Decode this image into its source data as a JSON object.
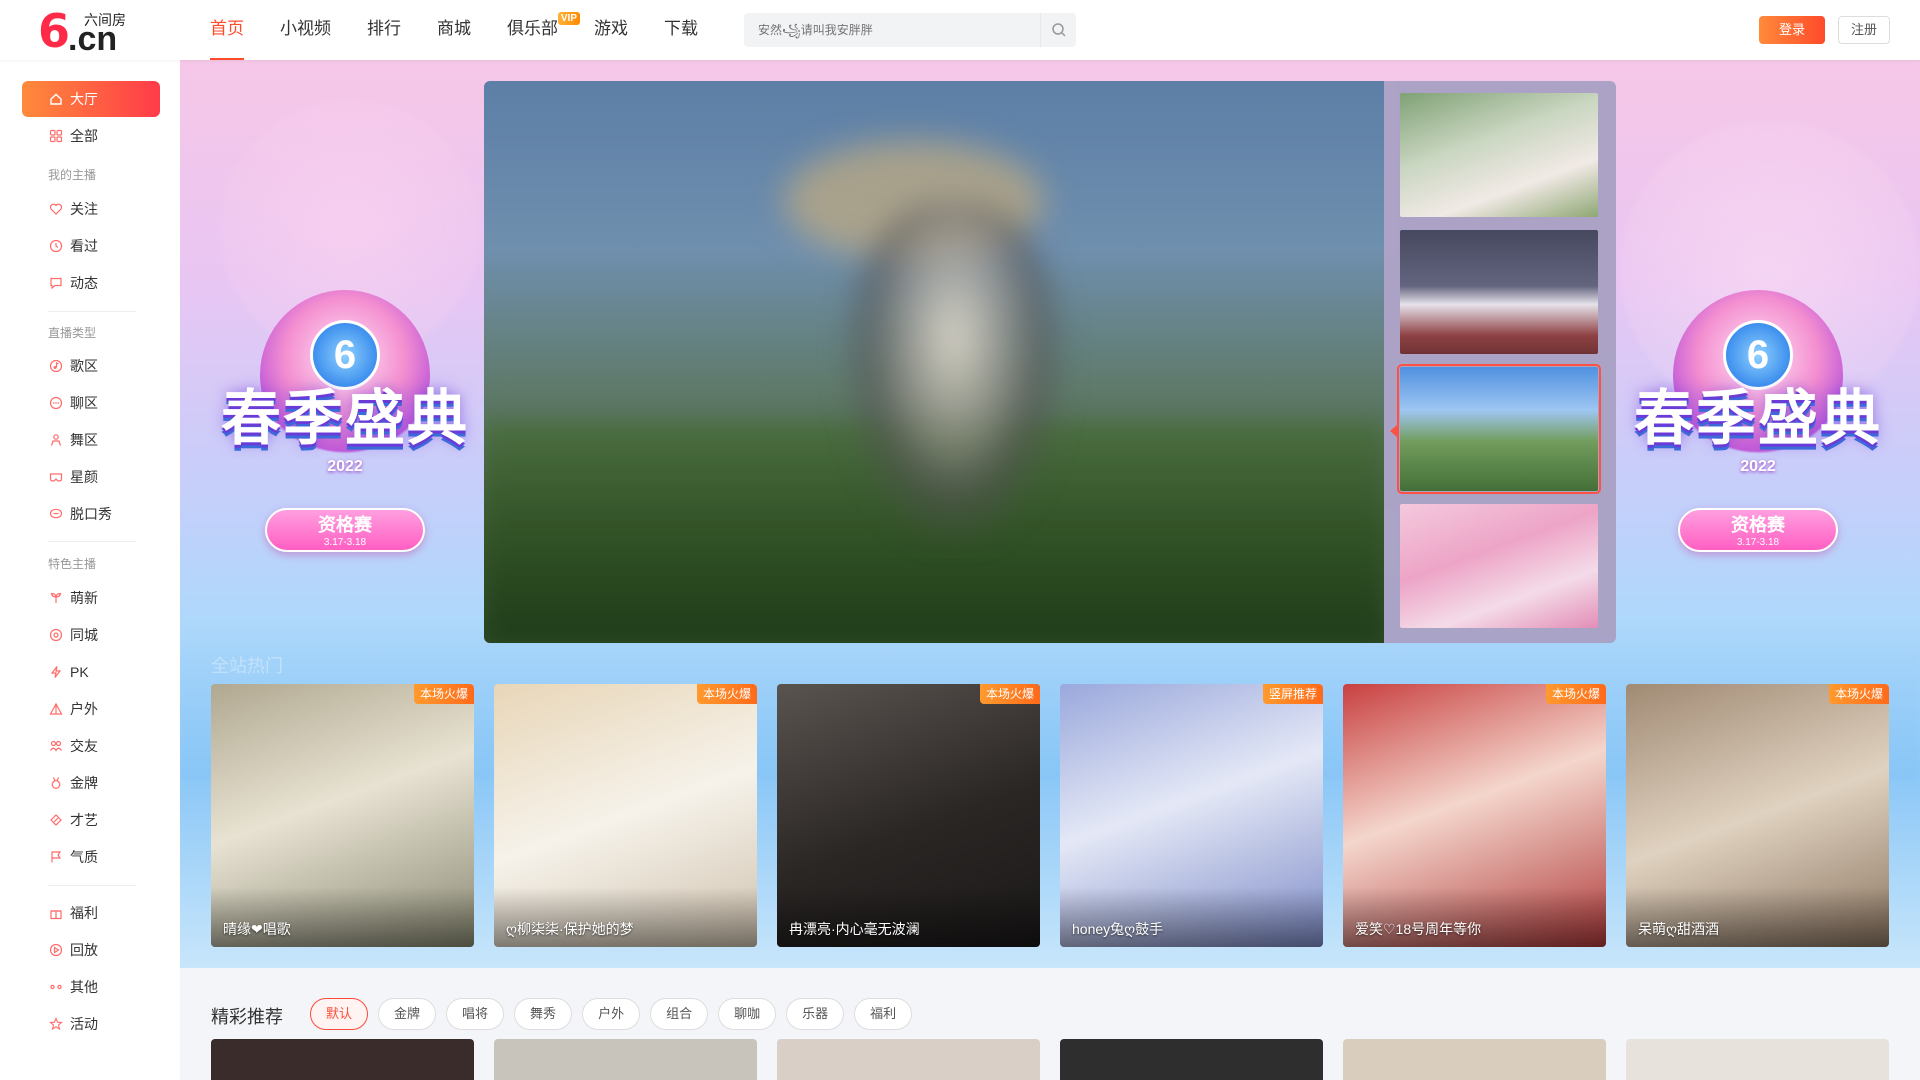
{
  "logo": {
    "glyph": "6",
    "domain": ".cn",
    "name": "六间房"
  },
  "nav": {
    "items": [
      {
        "label": "首页",
        "active": true
      },
      {
        "label": "小视频"
      },
      {
        "label": "排行"
      },
      {
        "label": "商城"
      },
      {
        "label": "俱乐部",
        "badge": "VIP"
      },
      {
        "label": "游戏"
      },
      {
        "label": "下载"
      }
    ]
  },
  "search": {
    "placeholder": "安然꧁请叫我安胖胖",
    "icon": "search-icon"
  },
  "auth": {
    "login": "登录",
    "register": "注册"
  },
  "sidebar": {
    "top": [
      {
        "label": "大厅",
        "icon": "home-icon",
        "active": true
      },
      {
        "label": "全部",
        "icon": "grid-icon"
      }
    ],
    "groups": [
      {
        "title": "我的主播",
        "items": [
          {
            "label": "关注",
            "icon": "heart-icon"
          },
          {
            "label": "看过",
            "icon": "clock-icon"
          },
          {
            "label": "动态",
            "icon": "message-icon"
          }
        ]
      },
      {
        "title": "直播类型",
        "items": [
          {
            "label": "歌区",
            "icon": "music-icon"
          },
          {
            "label": "聊区",
            "icon": "chat-icon"
          },
          {
            "label": "舞区",
            "icon": "dance-icon"
          },
          {
            "label": "星颜",
            "icon": "mask-icon"
          },
          {
            "label": "脱口秀",
            "icon": "talk-icon"
          }
        ]
      },
      {
        "title": "特色主播",
        "items": [
          {
            "label": "萌新",
            "icon": "sprout-icon"
          },
          {
            "label": "同城",
            "icon": "location-icon"
          },
          {
            "label": "PK",
            "icon": "lightning-icon"
          },
          {
            "label": "户外",
            "icon": "tent-icon"
          },
          {
            "label": "交友",
            "icon": "friends-icon"
          },
          {
            "label": "金牌",
            "icon": "medal-icon"
          },
          {
            "label": "才艺",
            "icon": "talent-icon"
          },
          {
            "label": "气质",
            "icon": "flag-icon"
          }
        ]
      },
      {
        "title": "",
        "items": [
          {
            "label": "福利",
            "icon": "gift-icon"
          },
          {
            "label": "回放",
            "icon": "replay-icon"
          },
          {
            "label": "其他",
            "icon": "dots-icon"
          },
          {
            "label": "活动",
            "icon": "star-icon"
          }
        ]
      }
    ]
  },
  "banner": {
    "festival": {
      "glyph": "6",
      "title": "春季盛典",
      "year": "2022",
      "stage": "资格赛",
      "dates": "3.17-3.18"
    }
  },
  "hot": {
    "section_title": "全站热门",
    "cards": [
      {
        "name": "晴缘❤唱歌",
        "tag": "本场火爆",
        "bg": "#d8d2c4"
      },
      {
        "name": "ღ柳柒柒·保护她的梦",
        "tag": "本场火爆",
        "bg": "#e9e2d6"
      },
      {
        "name": "冉漂亮·内心毫无波澜",
        "tag": "本场火爆",
        "bg": "#3a3634"
      },
      {
        "name": "honey兔ღ鼓手",
        "tag": "竖屏推荐",
        "bg": "#c9cfe8"
      },
      {
        "name": "爱笑♡18号周年等你",
        "tag": "本场火爆",
        "bg": "#d9a3a0"
      },
      {
        "name": "呆萌ღ甜酒酒",
        "tag": "本场火爆",
        "bg": "#c8b7a4"
      }
    ]
  },
  "recommend": {
    "title": "精彩推荐",
    "filters": [
      "默认",
      "金牌",
      "唱将",
      "舞秀",
      "户外",
      "组合",
      "聊咖",
      "乐器",
      "福利"
    ],
    "active_filter": "默认",
    "cards": [
      {
        "bg": "#3b2c2c"
      },
      {
        "bg": "#c8c4bc"
      },
      {
        "bg": "#d9cfc7"
      },
      {
        "bg": "#2e2e2e"
      },
      {
        "bg": "#d9cdbd"
      },
      {
        "bg": "#e8e2dc"
      }
    ]
  },
  "colors": {
    "accent": "#ff4b2b",
    "tag": "#ff7a1f"
  }
}
